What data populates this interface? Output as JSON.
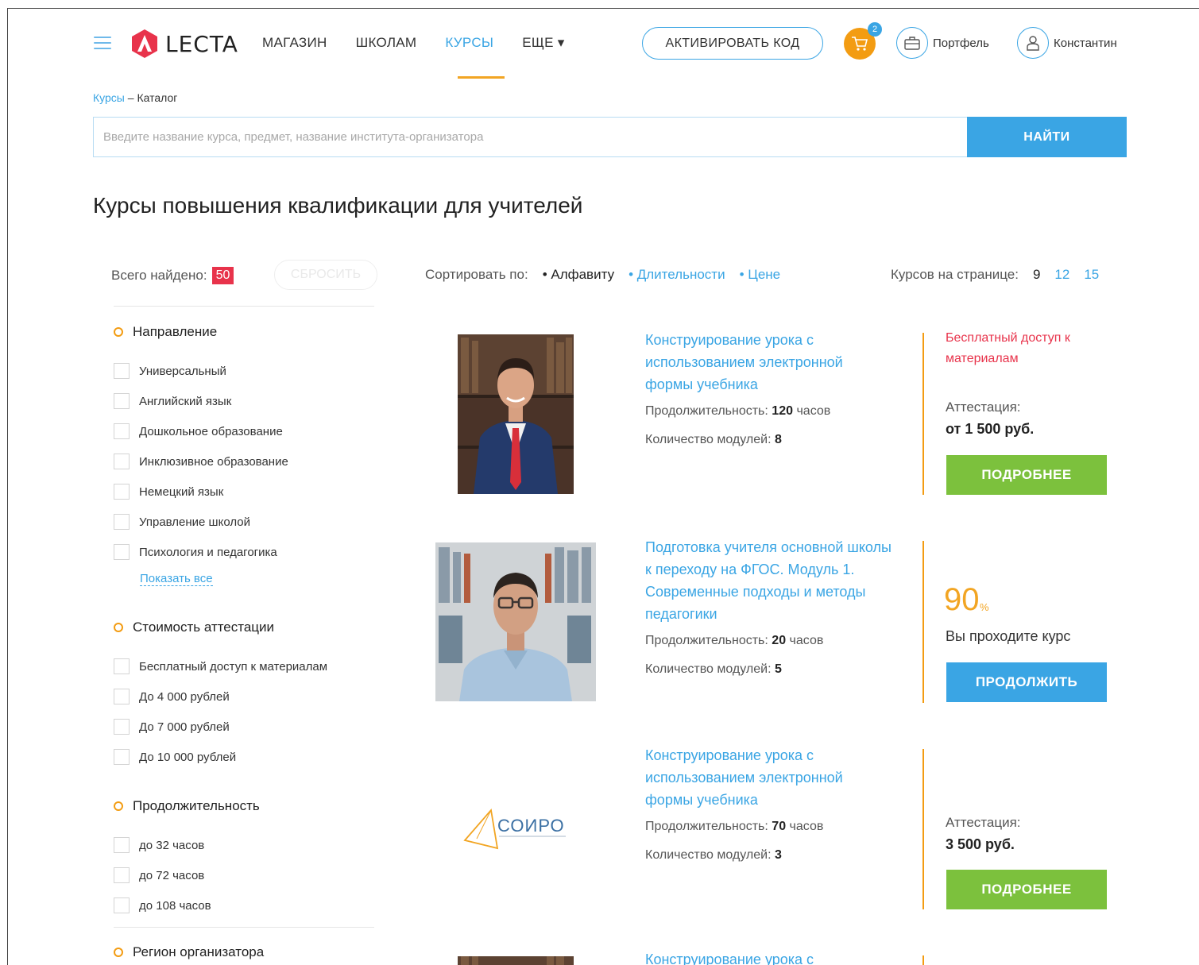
{
  "header": {
    "logo_text": "LECTA",
    "nav": [
      "МАГАЗИН",
      "ШКОЛАМ",
      "КУРСЫ",
      "ЕЩЕ ▾"
    ],
    "active_nav": "КУРСЫ",
    "activate_code": "АКТИВИРОВАТЬ КОД",
    "cart_badge": "2",
    "portfolio": "Портфель",
    "user": "Константин"
  },
  "breadcrumb": {
    "root": "Курсы",
    "separator": " – ",
    "current": "Каталог"
  },
  "search": {
    "placeholder": "Введите название курса, предмет, название института-организатора",
    "button": "НАЙТИ"
  },
  "page_title": "Курсы повышения квалификации для учителей",
  "toolbar": {
    "found_label": "Всего найдено:",
    "found_count": "50",
    "reset": "СБРОСИТЬ",
    "sort_label": "Сортировать по:",
    "sort_options": [
      "• Алфавиту",
      "• Длительности",
      "• Цене"
    ],
    "per_page_label": "Курсов на странице:",
    "per_page_options": [
      "9",
      "12",
      "15"
    ]
  },
  "filters": {
    "direction": {
      "title": "Направление",
      "items": [
        "Универсальный",
        "Английский язык",
        "Дошкольное образование",
        "Инклюзивное образование",
        "Немецкий язык",
        "Управление школой",
        "Психология и педагогика"
      ],
      "show_all": "Показать все"
    },
    "cost": {
      "title": "Стоимость аттестации",
      "items": [
        "Бесплатный доступ к материалам",
        "До 4 000 рублей",
        "До 7 000 рублей",
        "До 10 000 рублей"
      ]
    },
    "duration": {
      "title": "Продолжительность",
      "items": [
        "до 32 часов",
        "до 72 часов",
        "до 108 часов"
      ]
    },
    "region": {
      "title": "Регион организатора"
    }
  },
  "courses": [
    {
      "title": "Конструирование урока с использованием электронной формы учебника",
      "duration_label": "Продолжительность:",
      "duration_value": "120",
      "duration_unit": "часов",
      "modules_label": "Количество модулей:",
      "modules_value": "8",
      "free": "Бесплатный доступ к материалам",
      "att_label": "Аттестация:",
      "att_price": "от 1 500 руб.",
      "button": "ПОДРОБНЕЕ"
    },
    {
      "title": "Подготовка учителя основной школы к переходу на ФГОС. Модуль 1. Современные подходы и методы педагогики",
      "duration_label": "Продолжительность:",
      "duration_value": "20",
      "duration_unit": "часов",
      "modules_label": "Количество модулей:",
      "modules_value": "5",
      "progress": "90",
      "progress_unit": "%",
      "progress_text": "Вы проходите курс",
      "button": "ПРОДОЛЖИТЬ"
    },
    {
      "title": "Конструирование урока с использованием электронной формы учебника",
      "duration_label": "Продолжительность:",
      "duration_value": "70",
      "duration_unit": "часов",
      "modules_label": "Количество модулей:",
      "modules_value": "3",
      "logo_text": "СОИРО",
      "att_label": "Аттестация:",
      "att_price": "3 500 руб.",
      "button": "ПОДРОБНЕЕ"
    },
    {
      "title": "Конструирование урока с"
    }
  ],
  "colors": {
    "accent": "#3aa5e4",
    "orange": "#f39c12",
    "green": "#7cc13d",
    "red": "#e8334b"
  }
}
